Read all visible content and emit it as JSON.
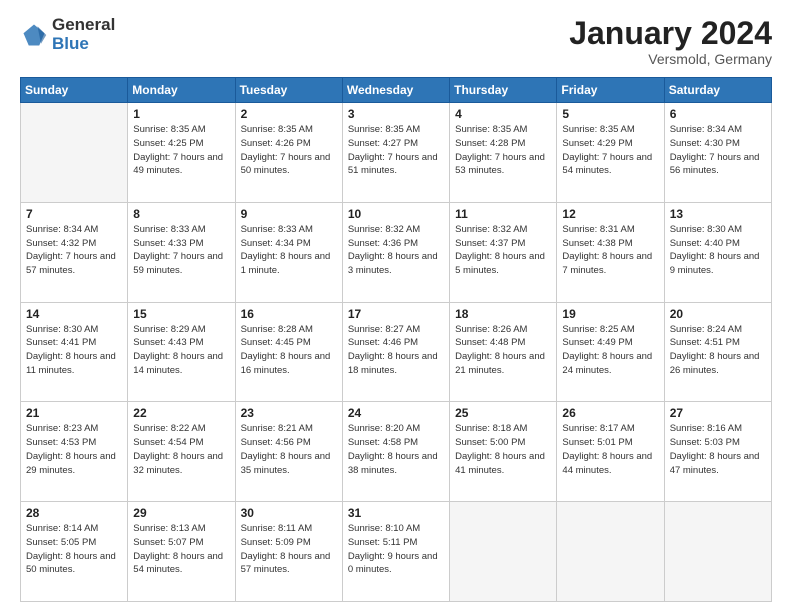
{
  "header": {
    "logo": {
      "general": "General",
      "blue": "Blue"
    },
    "title": "January 2024",
    "subtitle": "Versmold, Germany"
  },
  "weekdays": [
    "Sunday",
    "Monday",
    "Tuesday",
    "Wednesday",
    "Thursday",
    "Friday",
    "Saturday"
  ],
  "weeks": [
    [
      {
        "day": "",
        "empty": true
      },
      {
        "day": "1",
        "sunrise": "Sunrise: 8:35 AM",
        "sunset": "Sunset: 4:25 PM",
        "daylight": "Daylight: 7 hours and 49 minutes."
      },
      {
        "day": "2",
        "sunrise": "Sunrise: 8:35 AM",
        "sunset": "Sunset: 4:26 PM",
        "daylight": "Daylight: 7 hours and 50 minutes."
      },
      {
        "day": "3",
        "sunrise": "Sunrise: 8:35 AM",
        "sunset": "Sunset: 4:27 PM",
        "daylight": "Daylight: 7 hours and 51 minutes."
      },
      {
        "day": "4",
        "sunrise": "Sunrise: 8:35 AM",
        "sunset": "Sunset: 4:28 PM",
        "daylight": "Daylight: 7 hours and 53 minutes."
      },
      {
        "day": "5",
        "sunrise": "Sunrise: 8:35 AM",
        "sunset": "Sunset: 4:29 PM",
        "daylight": "Daylight: 7 hours and 54 minutes."
      },
      {
        "day": "6",
        "sunrise": "Sunrise: 8:34 AM",
        "sunset": "Sunset: 4:30 PM",
        "daylight": "Daylight: 7 hours and 56 minutes."
      }
    ],
    [
      {
        "day": "7",
        "sunrise": "Sunrise: 8:34 AM",
        "sunset": "Sunset: 4:32 PM",
        "daylight": "Daylight: 7 hours and 57 minutes."
      },
      {
        "day": "8",
        "sunrise": "Sunrise: 8:33 AM",
        "sunset": "Sunset: 4:33 PM",
        "daylight": "Daylight: 7 hours and 59 minutes."
      },
      {
        "day": "9",
        "sunrise": "Sunrise: 8:33 AM",
        "sunset": "Sunset: 4:34 PM",
        "daylight": "Daylight: 8 hours and 1 minute."
      },
      {
        "day": "10",
        "sunrise": "Sunrise: 8:32 AM",
        "sunset": "Sunset: 4:36 PM",
        "daylight": "Daylight: 8 hours and 3 minutes."
      },
      {
        "day": "11",
        "sunrise": "Sunrise: 8:32 AM",
        "sunset": "Sunset: 4:37 PM",
        "daylight": "Daylight: 8 hours and 5 minutes."
      },
      {
        "day": "12",
        "sunrise": "Sunrise: 8:31 AM",
        "sunset": "Sunset: 4:38 PM",
        "daylight": "Daylight: 8 hours and 7 minutes."
      },
      {
        "day": "13",
        "sunrise": "Sunrise: 8:30 AM",
        "sunset": "Sunset: 4:40 PM",
        "daylight": "Daylight: 8 hours and 9 minutes."
      }
    ],
    [
      {
        "day": "14",
        "sunrise": "Sunrise: 8:30 AM",
        "sunset": "Sunset: 4:41 PM",
        "daylight": "Daylight: 8 hours and 11 minutes."
      },
      {
        "day": "15",
        "sunrise": "Sunrise: 8:29 AM",
        "sunset": "Sunset: 4:43 PM",
        "daylight": "Daylight: 8 hours and 14 minutes."
      },
      {
        "day": "16",
        "sunrise": "Sunrise: 8:28 AM",
        "sunset": "Sunset: 4:45 PM",
        "daylight": "Daylight: 8 hours and 16 minutes."
      },
      {
        "day": "17",
        "sunrise": "Sunrise: 8:27 AM",
        "sunset": "Sunset: 4:46 PM",
        "daylight": "Daylight: 8 hours and 18 minutes."
      },
      {
        "day": "18",
        "sunrise": "Sunrise: 8:26 AM",
        "sunset": "Sunset: 4:48 PM",
        "daylight": "Daylight: 8 hours and 21 minutes."
      },
      {
        "day": "19",
        "sunrise": "Sunrise: 8:25 AM",
        "sunset": "Sunset: 4:49 PM",
        "daylight": "Daylight: 8 hours and 24 minutes."
      },
      {
        "day": "20",
        "sunrise": "Sunrise: 8:24 AM",
        "sunset": "Sunset: 4:51 PM",
        "daylight": "Daylight: 8 hours and 26 minutes."
      }
    ],
    [
      {
        "day": "21",
        "sunrise": "Sunrise: 8:23 AM",
        "sunset": "Sunset: 4:53 PM",
        "daylight": "Daylight: 8 hours and 29 minutes."
      },
      {
        "day": "22",
        "sunrise": "Sunrise: 8:22 AM",
        "sunset": "Sunset: 4:54 PM",
        "daylight": "Daylight: 8 hours and 32 minutes."
      },
      {
        "day": "23",
        "sunrise": "Sunrise: 8:21 AM",
        "sunset": "Sunset: 4:56 PM",
        "daylight": "Daylight: 8 hours and 35 minutes."
      },
      {
        "day": "24",
        "sunrise": "Sunrise: 8:20 AM",
        "sunset": "Sunset: 4:58 PM",
        "daylight": "Daylight: 8 hours and 38 minutes."
      },
      {
        "day": "25",
        "sunrise": "Sunrise: 8:18 AM",
        "sunset": "Sunset: 5:00 PM",
        "daylight": "Daylight: 8 hours and 41 minutes."
      },
      {
        "day": "26",
        "sunrise": "Sunrise: 8:17 AM",
        "sunset": "Sunset: 5:01 PM",
        "daylight": "Daylight: 8 hours and 44 minutes."
      },
      {
        "day": "27",
        "sunrise": "Sunrise: 8:16 AM",
        "sunset": "Sunset: 5:03 PM",
        "daylight": "Daylight: 8 hours and 47 minutes."
      }
    ],
    [
      {
        "day": "28",
        "sunrise": "Sunrise: 8:14 AM",
        "sunset": "Sunset: 5:05 PM",
        "daylight": "Daylight: 8 hours and 50 minutes."
      },
      {
        "day": "29",
        "sunrise": "Sunrise: 8:13 AM",
        "sunset": "Sunset: 5:07 PM",
        "daylight": "Daylight: 8 hours and 54 minutes."
      },
      {
        "day": "30",
        "sunrise": "Sunrise: 8:11 AM",
        "sunset": "Sunset: 5:09 PM",
        "daylight": "Daylight: 8 hours and 57 minutes."
      },
      {
        "day": "31",
        "sunrise": "Sunrise: 8:10 AM",
        "sunset": "Sunset: 5:11 PM",
        "daylight": "Daylight: 9 hours and 0 minutes."
      },
      {
        "day": "",
        "empty": true
      },
      {
        "day": "",
        "empty": true
      },
      {
        "day": "",
        "empty": true
      }
    ]
  ]
}
